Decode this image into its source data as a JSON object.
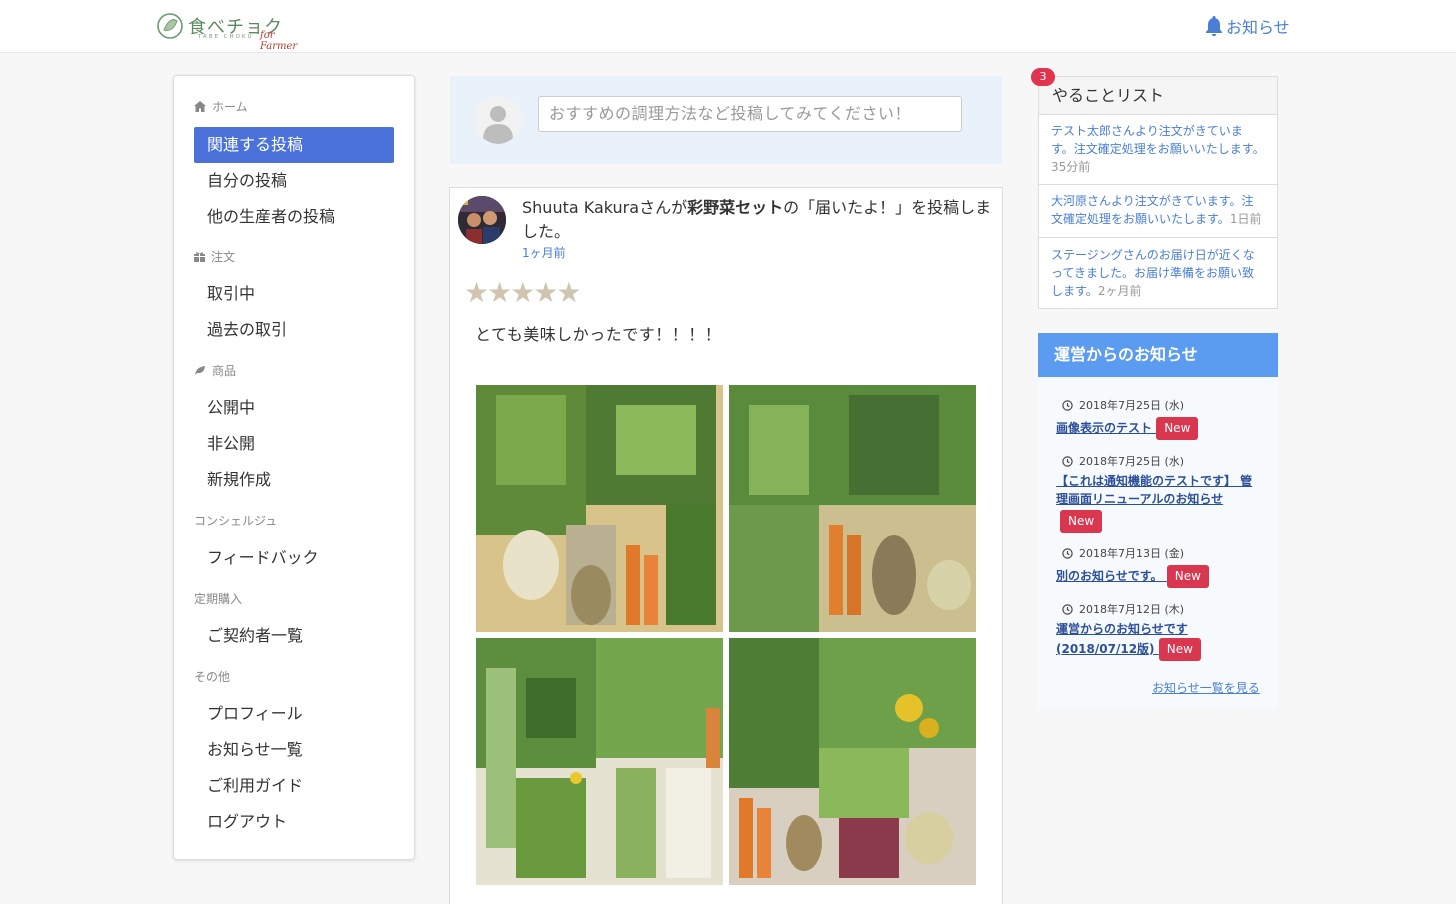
{
  "header": {
    "logo_text": "食べチョク",
    "logo_sub": "TABE CHOKU",
    "logo_farmer": "for Farmer",
    "notifications_label": "お知らせ"
  },
  "sidebar": {
    "sections": {
      "home": "ホーム",
      "orders": "注文",
      "products": "商品",
      "concierge": "コンシェルジュ",
      "subscription": "定期購入",
      "other": "その他"
    },
    "items": {
      "related_posts": "関連する投稿",
      "my_posts": "自分の投稿",
      "other_producers": "他の生産者の投稿",
      "in_progress": "取引中",
      "past": "過去の取引",
      "published": "公開中",
      "unpublished": "非公開",
      "new": "新規作成",
      "feedback": "フィードバック",
      "subscribers": "ご契約者一覧",
      "profile": "プロフィール",
      "news_list": "お知らせ一覧",
      "guide": "ご利用ガイド",
      "logout": "ログアウト"
    }
  },
  "compose": {
    "placeholder": "おすすめの調理方法など投稿してみてください！"
  },
  "feed": {
    "user": "Shuuta Kakura",
    "san_ga": "さんが",
    "product": "彩野菜セット",
    "rest": "の「届いたよ！」を投稿しました。",
    "time": "1ヶ月前",
    "rating": 5,
    "stars": "★★★★★",
    "text": "とても美味しかったです！！！！"
  },
  "todo": {
    "title": "やることリスト",
    "count": "3",
    "items": [
      {
        "text": "テスト太郎さんより注文がきています。注文確定処理をお願いいたします。",
        "ago": "35分前"
      },
      {
        "text": "大河原さんより注文がきています。注文確定処理をお願いいたします。",
        "ago": "1日前"
      },
      {
        "text": "ステージングさんのお届け日が近くなってきました。お届け準備をお願い致します。",
        "ago": "2ヶ月前"
      }
    ]
  },
  "news": {
    "title": "運営からのお知らせ",
    "new_label": "New",
    "items": [
      {
        "date": "2018年7月25日 (水)",
        "title": "画像表示のテスト"
      },
      {
        "date": "2018年7月25日 (水)",
        "title": "【これは通知機能のテストです】 管理画面リニューアルのお知らせ"
      },
      {
        "date": "2018年7月13日 (金)",
        "title": "別のお知らせです。"
      },
      {
        "date": "2018年7月12日 (木)",
        "title": "運営からのお知らせです(2018/07/12版)"
      }
    ],
    "more": "お知らせ一覧を見る"
  },
  "colors": {
    "accent": "#4a72d9",
    "link": "#4a7fd4",
    "badge": "#d9364f",
    "news_header": "#5b9cf0"
  }
}
